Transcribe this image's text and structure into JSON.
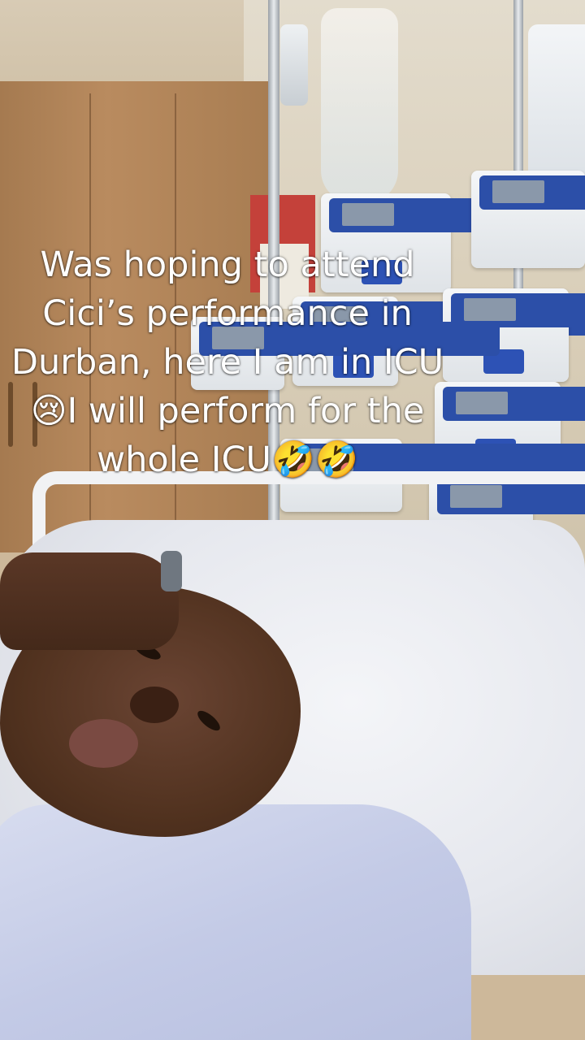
{
  "caption": {
    "line1": "Was hoping to attend",
    "line2": "Cici’s performance in",
    "line3": "Durban, here I am in ICU",
    "line4": "😢I will perform for the",
    "line5": "whole ICU🤣🤣"
  }
}
